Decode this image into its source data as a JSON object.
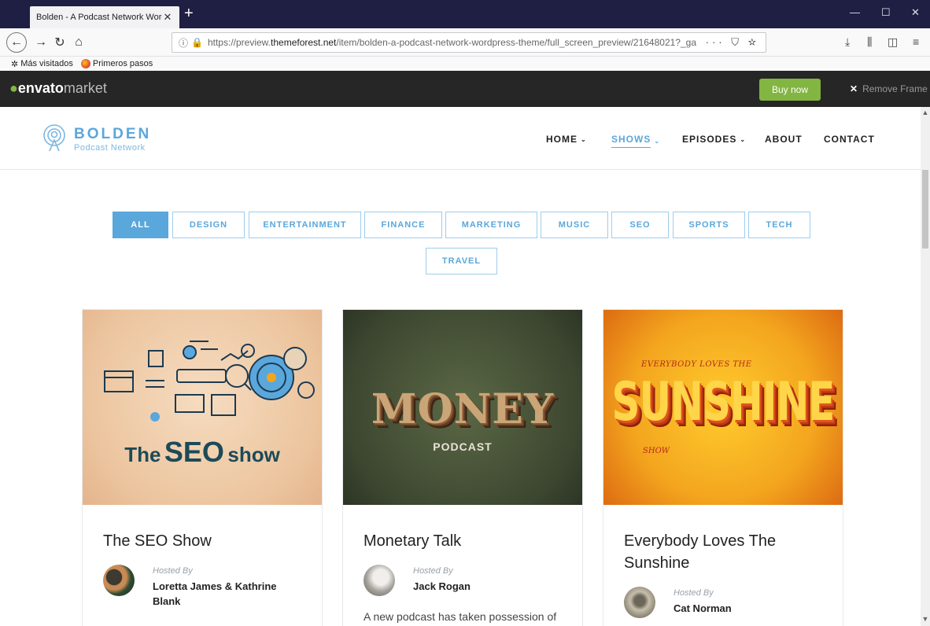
{
  "browser": {
    "tab_title": "Bolden - A Podcast Network WordP",
    "tab_close": "✕",
    "new_tab": "+",
    "url_prefix": "https://preview.",
    "url_domain": "themeforest.net",
    "url_rest": "/item/bolden-a-podcast-network-wordpress-theme/full_screen_preview/21648021?_ga",
    "url_icons": "··· ⛉ ☆",
    "bookmarks": [
      {
        "label": "Más visitados"
      },
      {
        "label": "Primeros pasos"
      }
    ]
  },
  "envato": {
    "logo_main": "envato",
    "logo_market": "market",
    "buy_now": "Buy now",
    "remove_frame": "Remove Frame",
    "remove_x": "✕"
  },
  "site": {
    "brand_name": "BOLDEN",
    "brand_sub": "Podcast Network",
    "nav": [
      {
        "label": "HOME",
        "chevron": "⌄"
      },
      {
        "label": "SHOWS",
        "chevron": "⌄"
      },
      {
        "label": "EPISODES",
        "chevron": "⌄"
      },
      {
        "label": "ABOUT"
      },
      {
        "label": "CONTACT"
      }
    ]
  },
  "filters": [
    "ALL",
    "DESIGN",
    "ENTERTAINMENT",
    "FINANCE",
    "MARKETING",
    "MUSIC",
    "SEO",
    "SPORTS",
    "TECH",
    "TRAVEL"
  ],
  "cards": [
    {
      "cover_text_1": "The",
      "cover_text_2": "SEO",
      "cover_text_3": "show",
      "title": "The SEO Show",
      "hosted_by": "Hosted By",
      "host": "Loretta James & Kathrine Blank"
    },
    {
      "cover_text_1": "MONEY",
      "cover_text_2": "PODCAST",
      "title": "Monetary Talk",
      "hosted_by": "Hosted By",
      "host": "Jack Rogan",
      "excerpt": "A new podcast has taken possession of"
    },
    {
      "cover_text_1": "EVERYBODY LOVES THE",
      "cover_text_2": "SUNSHINE",
      "cover_text_3": "SHOW",
      "title": "Everybody Loves The Sunshine",
      "hosted_by": "Hosted By",
      "host": "Cat Norman"
    }
  ]
}
